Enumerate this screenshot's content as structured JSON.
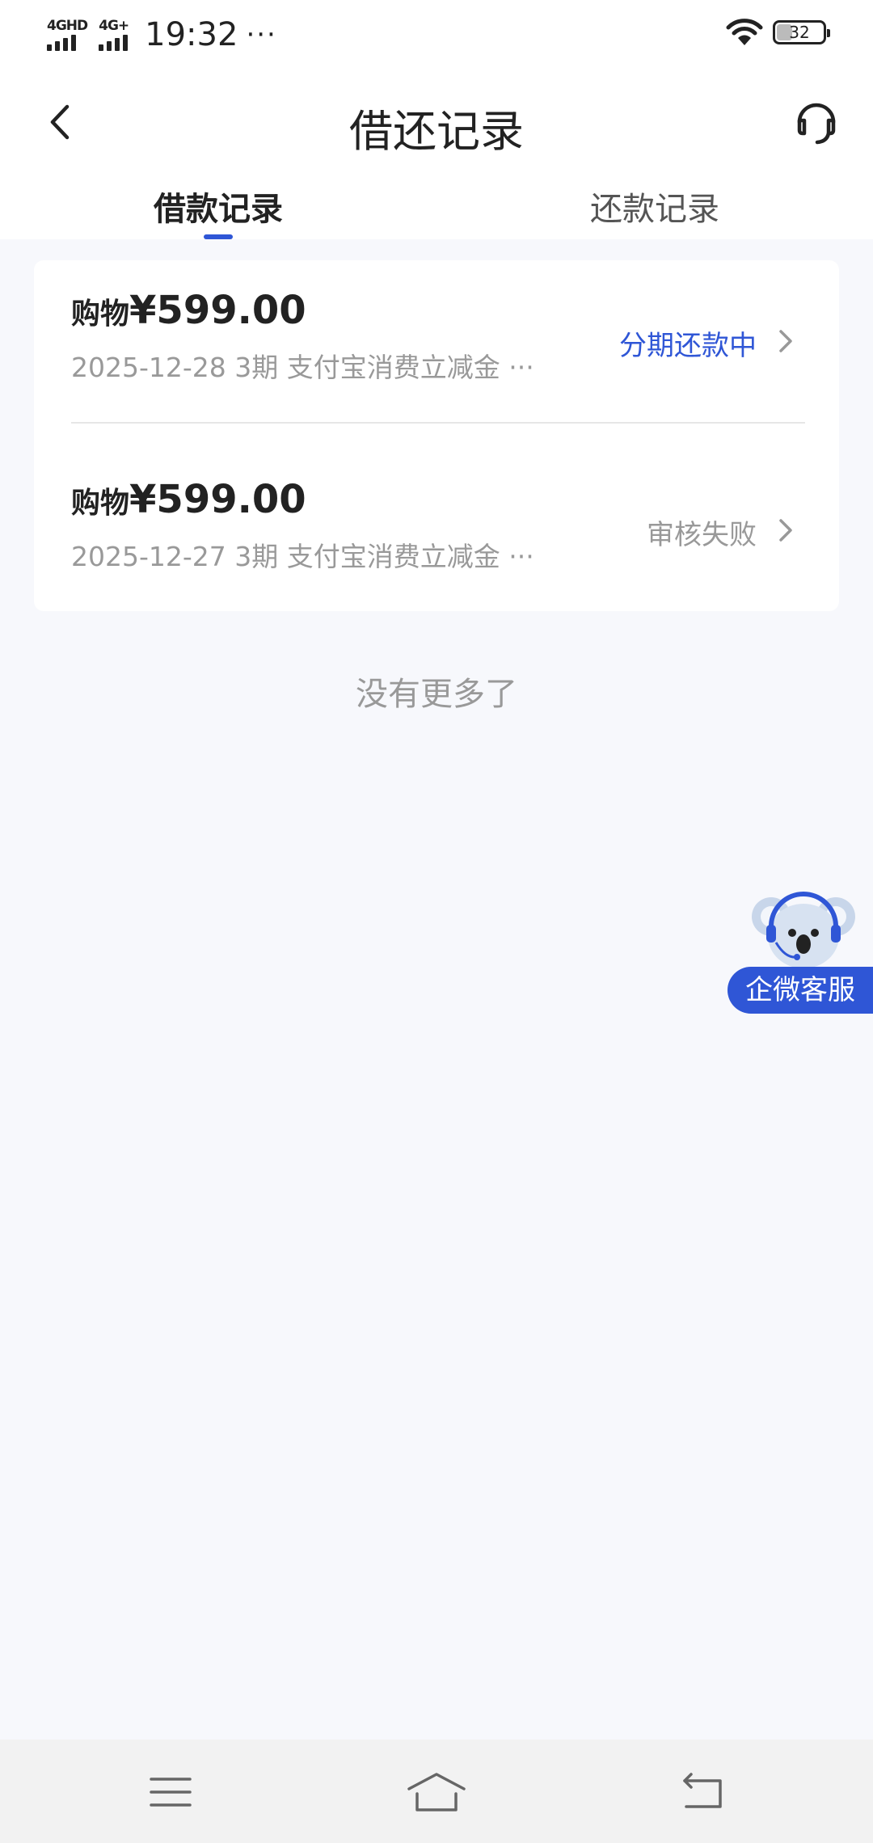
{
  "status_bar": {
    "network_1": "4GHD",
    "network_2": "4G+",
    "time": "19:32",
    "dots": "···",
    "battery": "32"
  },
  "header": {
    "title": "借还记录"
  },
  "tabs": [
    {
      "label": "借款记录",
      "active": true
    },
    {
      "label": "还款记录",
      "active": false
    }
  ],
  "records": [
    {
      "prefix": "购物",
      "amount": "¥599.00",
      "subtitle": "2025-12-28 3期  支付宝消费立减金 ···",
      "status": "分期还款中"
    },
    {
      "prefix": "购物",
      "amount": "¥599.00",
      "subtitle": "2025-12-27 3期  支付宝消费立减金 ···",
      "status": "审核失败"
    }
  ],
  "no_more": "没有更多了",
  "float_service": {
    "label": "企微客服"
  },
  "colors": {
    "accent": "#2f56d6",
    "background": "#f7f8fc"
  },
  "icons": [
    "back-arrow-icon",
    "headset-icon",
    "chevron-right-icon",
    "menu-icon",
    "home-icon",
    "back-nav-icon",
    "wifi-icon",
    "battery-icon"
  ]
}
